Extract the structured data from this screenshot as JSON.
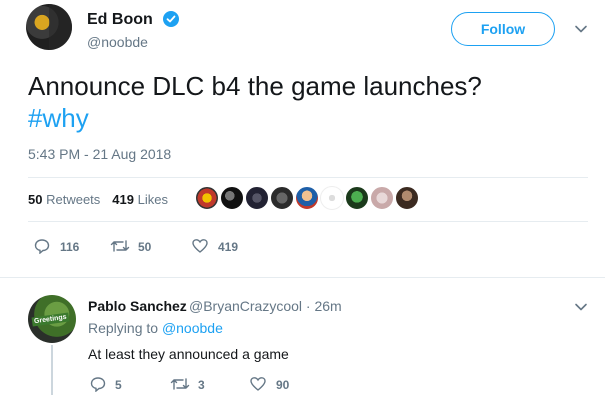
{
  "tweet": {
    "author_name": "Ed Boon",
    "author_handle": "@noobde",
    "follow_label": "Follow",
    "text_line1": "Announce DLC b4 the game launches?",
    "hashtag": "#why",
    "timestamp": "5:43 PM - 21 Aug 2018",
    "retweets_count": "50",
    "retweets_label": "Retweets",
    "likes_count": "419",
    "likes_label": "Likes",
    "actions": {
      "replies": "116",
      "retweets": "50",
      "likes": "419"
    }
  },
  "reply": {
    "author_name": "Pablo Sanchez",
    "meta": "@BryanCrazycool · 26m",
    "replying_prefix": "Replying to",
    "replying_handle": "@noobde",
    "text": "At least they announced a game",
    "avatar_text": "Greetings",
    "actions": {
      "replies": "5",
      "retweets": "3",
      "likes": "90"
    }
  },
  "colors": {
    "accent": "#1da1f2",
    "muted": "#657786",
    "text": "#14171a"
  },
  "icons": [
    "verified-icon",
    "chevron-down-icon",
    "reply-icon",
    "retweet-icon",
    "like-icon"
  ]
}
